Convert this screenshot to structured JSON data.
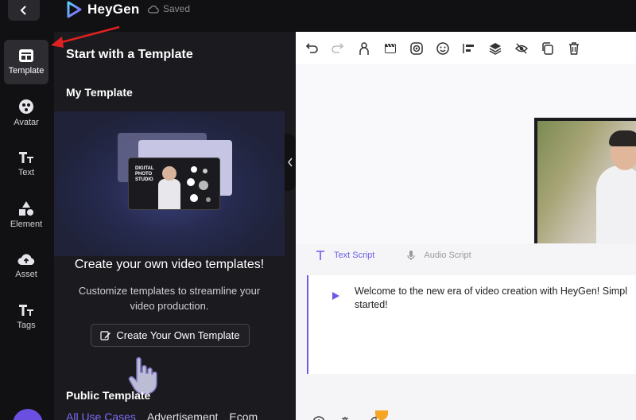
{
  "header": {
    "brand": "HeyGen",
    "save_status": "Saved"
  },
  "rail": {
    "items": [
      {
        "label": "Template",
        "active": true
      },
      {
        "label": "Avatar"
      },
      {
        "label": "Text"
      },
      {
        "label": "Element"
      },
      {
        "label": "Asset"
      },
      {
        "label": "Tags"
      }
    ]
  },
  "panel": {
    "title": "Start with a Template",
    "my_template_heading": "My Template",
    "promo": {
      "card_text": "DIGITAL PHOTO STUDIO",
      "title": "Create your own video templates!",
      "description": "Customize templates to streamline your video production.",
      "button_label": "Create Your Own Template"
    },
    "public_heading": "Public Template",
    "filter_tabs": [
      "All Use Cases",
      "Advertisement",
      "Ecom"
    ]
  },
  "editor": {
    "script_tabs": {
      "text": "Text Script",
      "audio": "Audio Script"
    },
    "script_text_line1": "Welcome to the new era of video creation with HeyGen! Simpl",
    "script_text_line2": "started!"
  },
  "colors": {
    "accent": "#6b5ce7",
    "annotation": "#e02020",
    "dark_bg": "#111114",
    "panel_bg": "#1b1b1f"
  }
}
